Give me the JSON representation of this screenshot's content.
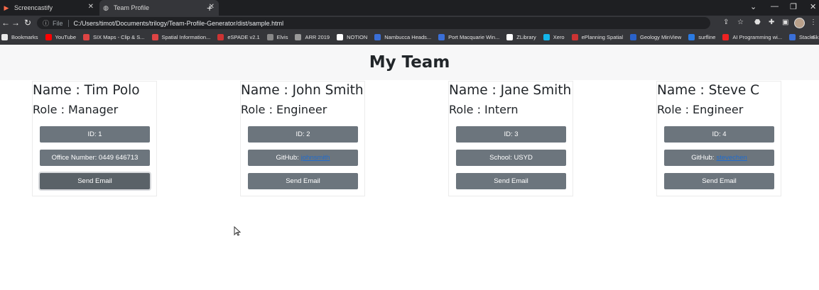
{
  "browser": {
    "tabs": [
      {
        "title": "Screencastify"
      },
      {
        "title": "Team Profile"
      }
    ],
    "omnibox": {
      "scheme": "File",
      "url": "C:/Users/timot/Documents/trilogy/Team-Profile-Generator/dist/sample.html"
    },
    "bookmarks": [
      {
        "label": "Bookmarks",
        "color": "#e8e8e8"
      },
      {
        "label": "YouTube",
        "color": "#ff0000"
      },
      {
        "label": "SIX Maps - Clip & S...",
        "color": "#d44"
      },
      {
        "label": "Spatial Information...",
        "color": "#d44"
      },
      {
        "label": "eSPADE v2.1",
        "color": "#c33"
      },
      {
        "label": "Elvis",
        "color": "#888"
      },
      {
        "label": "ARR 2019",
        "color": "#999"
      },
      {
        "label": "NOTION",
        "color": "#fff"
      },
      {
        "label": "Nambucca Heads...",
        "color": "#3a6fd8"
      },
      {
        "label": "Port Macquarie Win...",
        "color": "#3a6fd8"
      },
      {
        "label": "ZLibrary",
        "color": "#fff"
      },
      {
        "label": "Xero",
        "color": "#13b5ea"
      },
      {
        "label": "ePlanning Spatial",
        "color": "#c33"
      },
      {
        "label": "Geology MinView",
        "color": "#2a62c9"
      },
      {
        "label": "surfline",
        "color": "#2a7ae2"
      },
      {
        "label": "AI Programming wi...",
        "color": "#e22"
      },
      {
        "label": "StackSkills",
        "color": "#3a6fd8"
      }
    ]
  },
  "page": {
    "title": "My Team"
  },
  "team": [
    {
      "name": "Name : Tim Polo",
      "role": "Role : Manager",
      "id": "ID: 1",
      "detail": "Office Number: 0449 646713",
      "email": "Send Email"
    },
    {
      "name": "Name : John Smith",
      "role": "Role : Engineer",
      "id": "ID: 2",
      "detail": "GitHub:",
      "link": "johnsmith",
      "email": "Send Email"
    },
    {
      "name": "Name : Jane Smith",
      "role": "Role : Intern",
      "id": "ID: 3",
      "detail": "School: USYD",
      "email": "Send Email"
    },
    {
      "name": "Name : Steve C",
      "role": "Role : Engineer",
      "id": "ID: 4",
      "detail": "GitHub:",
      "link": "stevechen",
      "email": "Send Email"
    }
  ]
}
